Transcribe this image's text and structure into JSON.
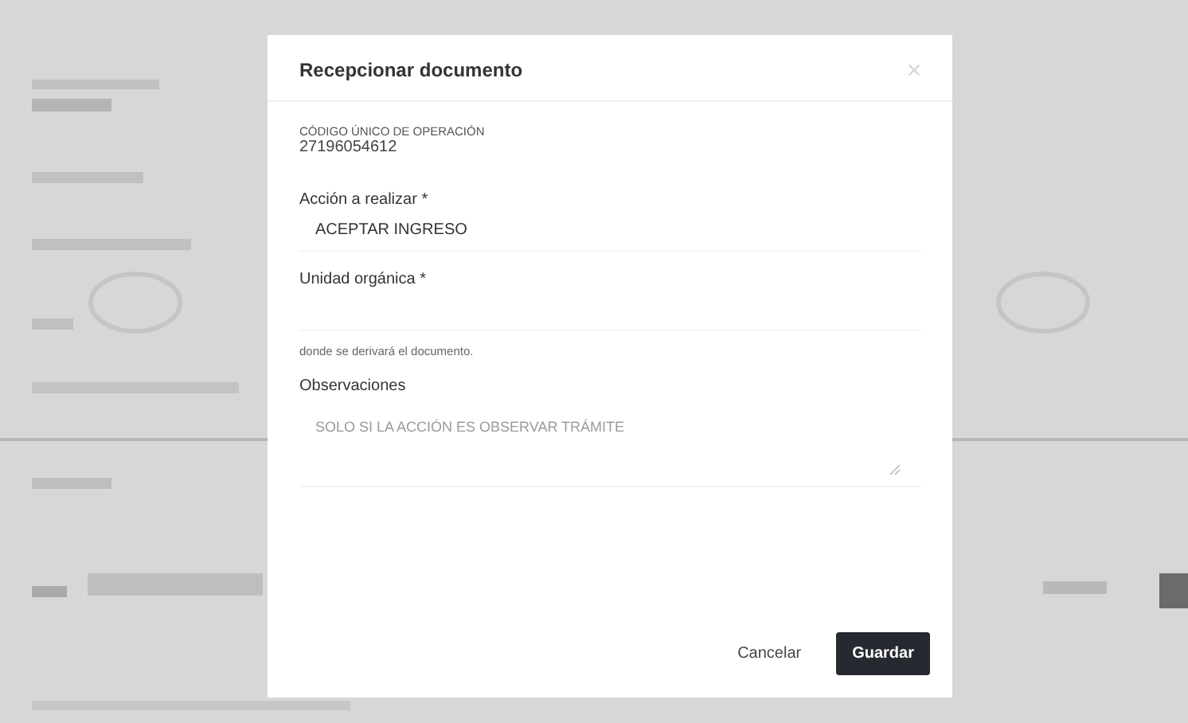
{
  "dialog": {
    "title": "Recepcionar documento",
    "operation_code": {
      "label": "CÓDIGO ÚNICO DE OPERACIÓN",
      "value": "27196054612"
    },
    "fields": [
      {
        "kind": "select",
        "label": "Acción a realizar *",
        "value": "ACEPTAR INGRESO"
      },
      {
        "kind": "select",
        "label": "Unidad orgánica *",
        "help": "donde se derivará el documento."
      },
      {
        "kind": "textarea",
        "label": "Observaciones",
        "placeholder": "SOLO SI LA ACCIÓN ES OBSERVAR TRÁMITE"
      }
    ],
    "buttons": [
      {
        "kind": "secondary",
        "label": "Cancelar"
      },
      {
        "kind": "primary",
        "label": "Guardar"
      }
    ]
  }
}
